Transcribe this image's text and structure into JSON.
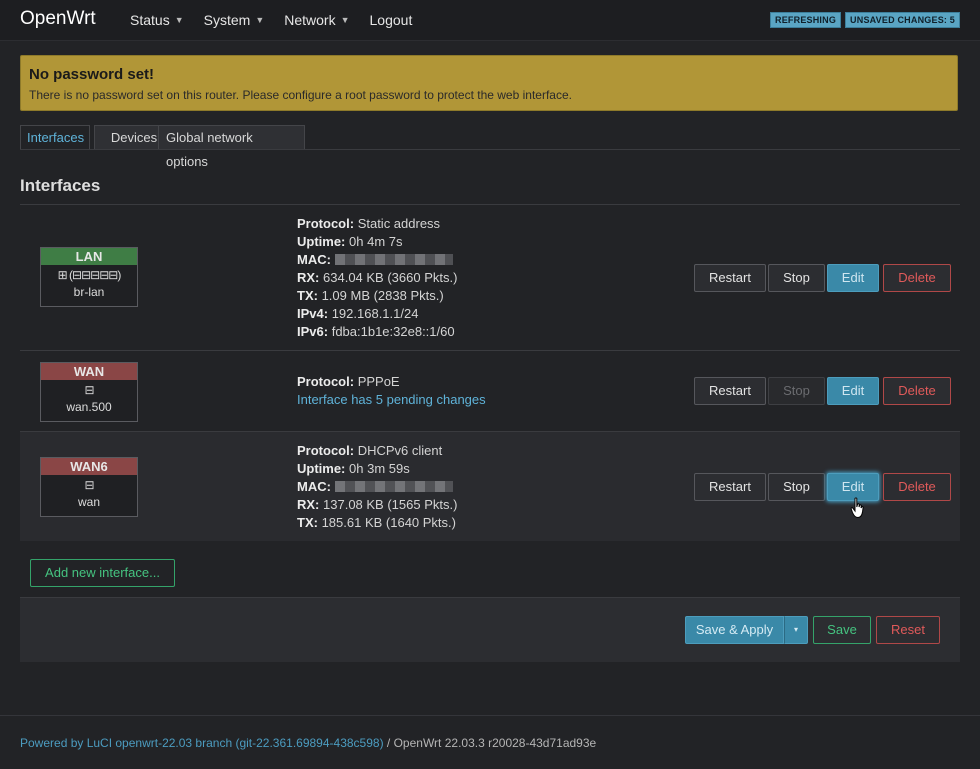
{
  "header": {
    "brand": "OpenWrt",
    "nav": [
      "Status",
      "System",
      "Network",
      "Logout"
    ],
    "badges": [
      "REFRESHING",
      "UNSAVED CHANGES: 5"
    ]
  },
  "alert": {
    "title": "No password set!",
    "message": "There is no password set on this router. Please configure a root password to protect the web interface."
  },
  "tabs": [
    "Interfaces",
    "Devices",
    "Global network options"
  ],
  "section_title": "Interfaces",
  "interfaces": [
    {
      "name": "LAN",
      "header_color": "#3f7d45",
      "icons": "⊞ (⊟⊟⊟⊟⊟)",
      "device": "br-lan",
      "protocol_label": "Protocol:",
      "protocol": "Static address",
      "uptime_label": "Uptime:",
      "uptime": "0h 4m 7s",
      "mac_label": "MAC:",
      "rx_label": "RX:",
      "rx": "634.04 KB (3660 Pkts.)",
      "tx_label": "TX:",
      "tx": "1.09 MB (2838 Pkts.)",
      "ipv4_label": "IPv4:",
      "ipv4": "192.168.1.1/24",
      "ipv6_label": "IPv6:",
      "ipv6": "fdba:1b1e:32e8::1/60"
    },
    {
      "name": "WAN",
      "header_color": "#8a4646",
      "icons": "⊟",
      "device": "wan.500",
      "protocol_label": "Protocol:",
      "protocol": "PPPoE",
      "pending": "Interface has 5 pending changes"
    },
    {
      "name": "WAN6",
      "header_color": "#8a4646",
      "icons": "⊟",
      "device": "wan",
      "protocol_label": "Protocol:",
      "protocol": "DHCPv6 client",
      "uptime_label": "Uptime:",
      "uptime": "0h 3m 59s",
      "mac_label": "MAC:",
      "rx_label": "RX:",
      "rx": "137.08 KB (1565 Pkts.)",
      "tx_label": "TX:",
      "tx": "185.61 KB (1640 Pkts.)"
    }
  ],
  "row_buttons": {
    "restart": "Restart",
    "stop": "Stop",
    "edit": "Edit",
    "delete": "Delete"
  },
  "add_interface": "Add new interface...",
  "actions": {
    "save_apply": "Save & Apply",
    "dropdown": "▾",
    "save": "Save",
    "reset": "Reset"
  },
  "footer": {
    "powered": "Powered by LuCI openwrt-22.03 branch (git-22.361.69894-438c598)",
    "separator": " / ",
    "version": "OpenWrt 22.03.3 r20028-43d71ad93e"
  }
}
